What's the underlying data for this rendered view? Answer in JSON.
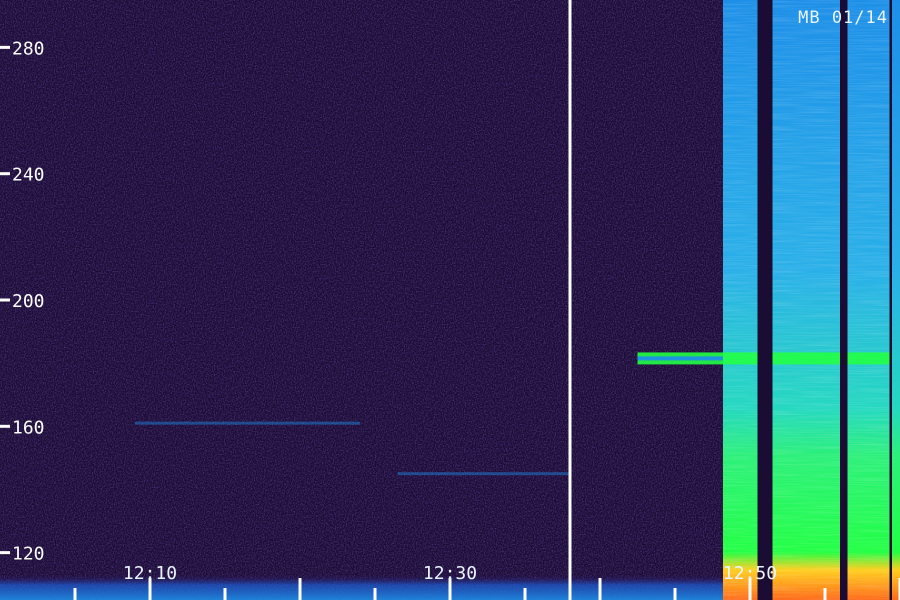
{
  "chart_data": {
    "type": "heatmap",
    "title": "",
    "stamp": "MB 01/14",
    "xlabel": "",
    "ylabel": "",
    "y_ticks": [
      120,
      160,
      200,
      240,
      280
    ],
    "y_tick_labels": [
      "120",
      "160",
      "200",
      "240",
      "280"
    ],
    "ylim": [
      105,
      295
    ],
    "x_time_labels": [
      "12:10",
      "12:30",
      "12:50"
    ],
    "x_label_minutes": [
      10,
      30,
      50
    ],
    "xlim_minutes": [
      0,
      60
    ],
    "x_minor_tick_interval_minutes": 5,
    "x_major_tick_interval_minutes": 10,
    "marker_line_minute": 38,
    "colors": {
      "background": "#1a0c33",
      "low_intensity": "#2b0f5e",
      "medium_intensity": "#1d8fe8",
      "high_intensity": "#22ff44",
      "peak_intensity": "#ff6a1a",
      "marker_line": "#ffffff"
    },
    "dark_gaps_minutes": [
      [
        50.5,
        51.5
      ],
      [
        56.0,
        56.5
      ],
      [
        59.3,
        60.0
      ]
    ],
    "bright_band_start_minute": 48.2,
    "faint_horizontal_features": [
      {
        "y_value": 181.5,
        "x_from_minutes": 42.5,
        "x_to_minutes": 60,
        "strength": "strong"
      },
      {
        "y_value": 145,
        "x_from_minutes": 26.5,
        "x_to_minutes": 38,
        "strength": "faint"
      },
      {
        "y_value": 161,
        "x_from_minutes": 9,
        "x_to_minutes": 24,
        "strength": "faint"
      }
    ]
  }
}
